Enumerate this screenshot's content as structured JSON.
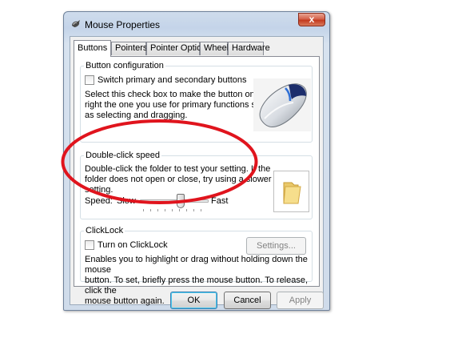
{
  "window": {
    "title": "Mouse Properties",
    "close_glyph": "x"
  },
  "tabs": [
    {
      "label": "Buttons",
      "active": true
    },
    {
      "label": "Pointers",
      "active": false
    },
    {
      "label": "Pointer Options",
      "active": false
    },
    {
      "label": "Wheel",
      "active": false
    },
    {
      "label": "Hardware",
      "active": false
    }
  ],
  "button_config": {
    "legend": "Button configuration",
    "checkbox_label": "Switch primary and secondary buttons",
    "checked": false,
    "description_lines": [
      "Select this check box to make the button on the",
      "right the one you use for primary functions such",
      "as selecting and dragging."
    ],
    "image_icon": "mouse-image"
  },
  "double_click": {
    "legend": "Double-click speed",
    "description_lines": [
      "Double-click the folder to test your setting. If the",
      "folder does not open or close, try using a slower",
      "setting."
    ],
    "speed_label": "Speed:",
    "slow_label": "Slow",
    "fast_label": "Fast",
    "slider_value_fraction": 0.6,
    "test_icon": "folder-icon",
    "highlight_color": "#e0141d"
  },
  "clicklock": {
    "legend": "ClickLock",
    "checkbox_label": "Turn on ClickLock",
    "checked": false,
    "settings_button": "Settings...",
    "settings_enabled": false,
    "description_lines": [
      "Enables you to highlight or drag without holding down the mouse",
      "button. To set, briefly press the mouse button. To release, click the",
      "mouse button again."
    ]
  },
  "footer": {
    "ok": "OK",
    "cancel": "Cancel",
    "apply": "Apply",
    "apply_enabled": false
  }
}
